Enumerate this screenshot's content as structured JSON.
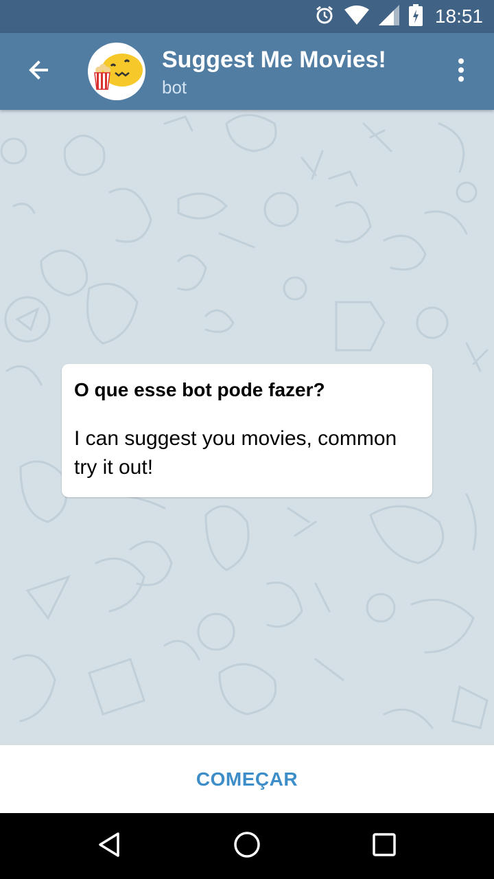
{
  "status_bar": {
    "time": "18:51",
    "icons": [
      "alarm-icon",
      "wifi-icon",
      "signal-icon",
      "battery-icon"
    ]
  },
  "header": {
    "title": "Suggest Me Movies!",
    "subtitle": "bot",
    "back_icon": "arrow-left-icon",
    "menu_icon": "more-vertical-icon",
    "avatar_icon": "popcorn-bot-icon"
  },
  "info_card": {
    "title": "O que esse bot pode fazer?",
    "text": "I can suggest you movies, common try it out!"
  },
  "bottom_bar": {
    "start_label": "COMEÇAR"
  },
  "nav_bar": {
    "icons": [
      "back-triangle-icon",
      "home-circle-icon",
      "recents-square-icon"
    ]
  },
  "colors": {
    "status_bar": "#3f6285",
    "app_bar": "#527da3",
    "chat_background": "#d4dfe6",
    "accent": "#3d8dc8"
  }
}
